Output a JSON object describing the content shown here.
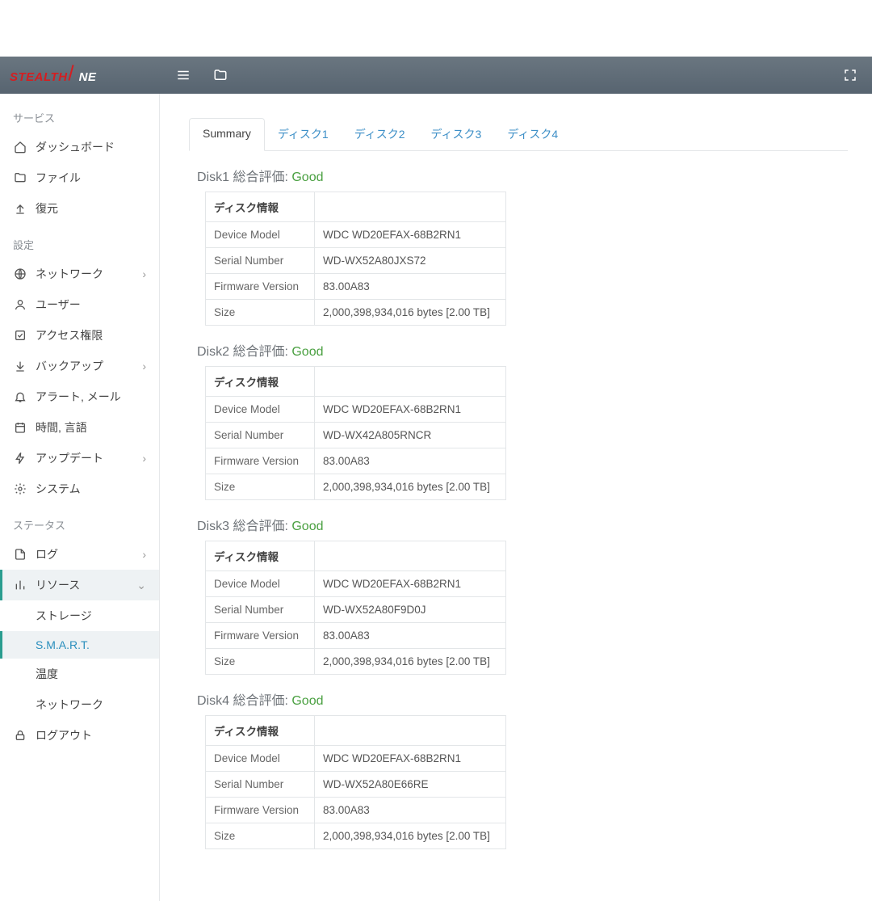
{
  "logo": {
    "part1": "STEALTH",
    "part2": "NE"
  },
  "sidebar": {
    "service": "サービス",
    "dashboard": "ダッシュボード",
    "file": "ファイル",
    "restore": "復元",
    "settings": "設定",
    "network": "ネットワーク",
    "user": "ユーザー",
    "access": "アクセス権限",
    "backup": "バックアップ",
    "alert": "アラート, メール",
    "timelang": "時間, 言語",
    "update": "アップデート",
    "system": "システム",
    "status": "ステータス",
    "log": "ログ",
    "resource": "リソース",
    "storage": "ストレージ",
    "smart": "S.M.A.R.T.",
    "temp": "温度",
    "network2": "ネットワーク",
    "logout": "ログアウト"
  },
  "tabs": [
    "Summary",
    "ディスク1",
    "ディスク2",
    "ディスク3",
    "ディスク4"
  ],
  "labels": {
    "info_header": "ディスク情報",
    "device_model": "Device Model",
    "serial": "Serial Number",
    "firmware": "Firmware Version",
    "size": "Size",
    "assessment": "総合評価:",
    "good": "Good"
  },
  "disks": [
    {
      "name": "Disk1",
      "model": "WDC WD20EFAX-68B2RN1",
      "serial": "WD-WX52A80JXS72",
      "fw": "83.00A83",
      "size": "2,000,398,934,016 bytes [2.00 TB]"
    },
    {
      "name": "Disk2",
      "model": "WDC WD20EFAX-68B2RN1",
      "serial": "WD-WX42A805RNCR",
      "fw": "83.00A83",
      "size": "2,000,398,934,016 bytes [2.00 TB]"
    },
    {
      "name": "Disk3",
      "model": "WDC WD20EFAX-68B2RN1",
      "serial": "WD-WX52A80F9D0J",
      "fw": "83.00A83",
      "size": "2,000,398,934,016 bytes [2.00 TB]"
    },
    {
      "name": "Disk4",
      "model": "WDC WD20EFAX-68B2RN1",
      "serial": "WD-WX52A80E66RE",
      "fw": "83.00A83",
      "size": "2,000,398,934,016 bytes [2.00 TB]"
    }
  ]
}
